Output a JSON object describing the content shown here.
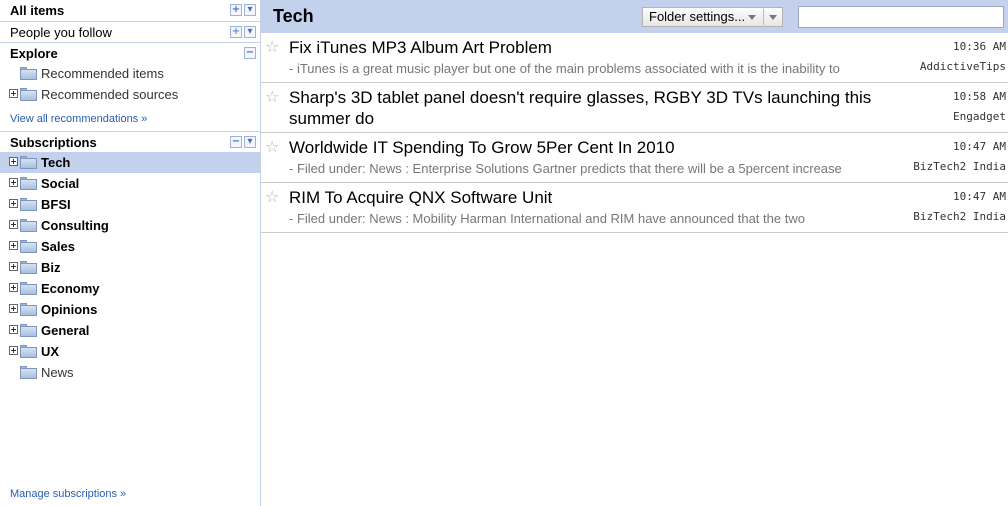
{
  "sidebar": {
    "all_items": "All items",
    "people_you_follow": "People you follow",
    "explore": {
      "heading": "Explore",
      "items": [
        "Recommended items",
        "Recommended sources"
      ],
      "view_all": "View all recommendations »"
    },
    "subscriptions": {
      "heading": "Subscriptions",
      "folders": [
        "Tech",
        "Social",
        "BFSI",
        "Consulting",
        "Sales",
        "Biz",
        "Economy",
        "Opinions",
        "General",
        "UX",
        "News"
      ],
      "selected": "Tech"
    },
    "manage": "Manage subscriptions »"
  },
  "header": {
    "title": "Tech",
    "folder_settings": "Folder settings...",
    "search_value": ""
  },
  "entries": [
    {
      "title": "Fix iTunes MP3 Album Art Problem",
      "snippet": "- iTunes is a great music player but one of the main problems associated with it is the inability to",
      "time": "10:36 AM",
      "source": "AddictiveTips"
    },
    {
      "title": "Sharp's 3D tablet panel doesn't require glasses, RGBY 3D TVs launching this summer do",
      "snippet": "",
      "time": "10:58 AM",
      "source": "Engadget"
    },
    {
      "title": "Worldwide IT Spending To Grow 5Per Cent In 2010",
      "snippet": "- Filed under: News : Enterprise Solutions Gartner predicts that there will be a 5percent increase",
      "time": "10:47 AM",
      "source": "BizTech2 India"
    },
    {
      "title": "RIM To Acquire QNX Software Unit",
      "snippet": "- Filed under: News : Mobility Harman International and RIM have announced that the two",
      "time": "10:47 AM",
      "source": "BizTech2 India"
    }
  ]
}
